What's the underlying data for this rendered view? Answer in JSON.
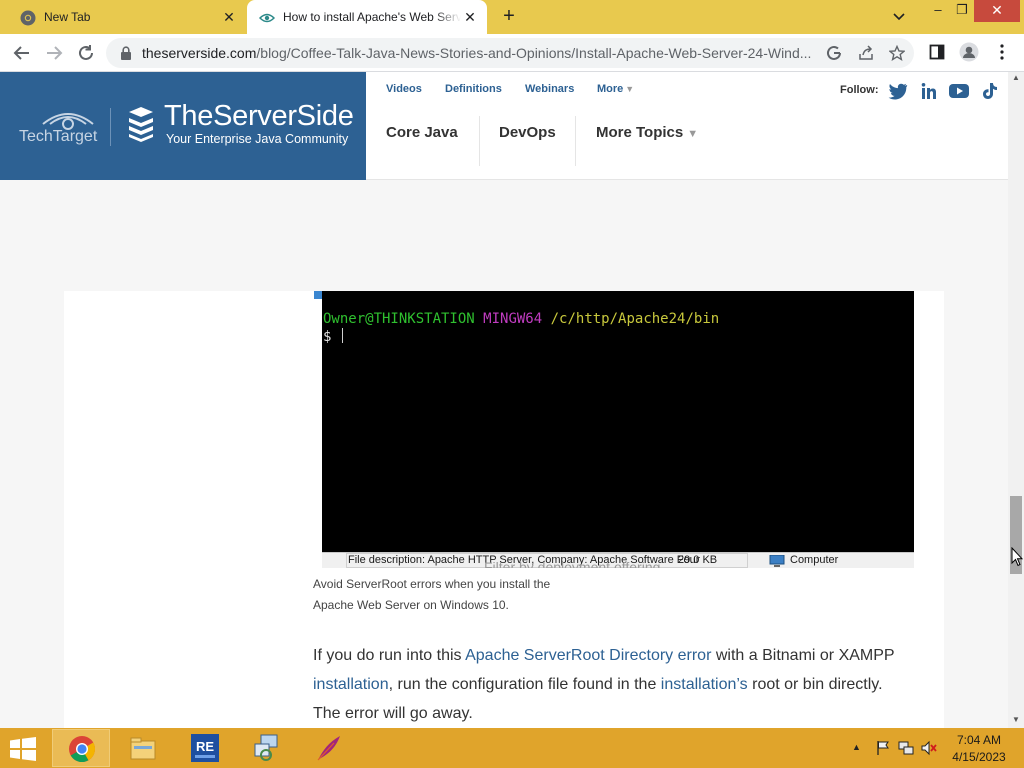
{
  "browser": {
    "tabs": [
      {
        "title": "New Tab",
        "active": false
      },
      {
        "title": "How to install Apache's Web Server",
        "active": true
      }
    ],
    "url_domain": "theserverside.com",
    "url_path": "/blog/Coffee-Talk-Java-News-Stories-and-Opinions/Install-Apache-Web-Server-24-Wind...",
    "colors": {
      "tabstrip": "#e8c94e",
      "close_button": "#c74a3d"
    }
  },
  "site_header": {
    "techtarget": "TechTarget",
    "brand_name": "TheServerSide",
    "tagline": "Your Enterprise Java Community",
    "top_links": [
      "Videos",
      "Definitions",
      "Webinars",
      "More"
    ],
    "follow_label": "Follow:",
    "social_icons": [
      "twitter-icon",
      "linkedin-icon",
      "youtube-icon",
      "tiktok-icon"
    ],
    "main_nav": [
      "Core Java",
      "DevOps",
      "More Topics"
    ],
    "colors": {
      "brand_blue": "#2d6193"
    }
  },
  "article": {
    "terminal": {
      "user_host": "Owner@THINKSTATION",
      "env": "MINGW64",
      "path": "/c/http/Apache24/bin",
      "prompt": "$ "
    },
    "explorer_status": {
      "description": "File description: Apache HTTP Server, Company: Apache Software Foundation",
      "size": "29.0 KB",
      "location": "Computer"
    },
    "behind_text": "Filter by deployment offering",
    "caption": "Avoid ServerRoot errors when you install the Apache Web Server on Windows 10.",
    "paragraph": {
      "t1": "If you do run into this ",
      "link1": "Apache ServerRoot Directory error",
      "t2": " with a Bitnami or XAMPP ",
      "link2": "installation",
      "t3": ", run the configuration file found in the ",
      "link3": "installation’s",
      "t4": " root or bin directly. The error will go away."
    }
  },
  "taskbar": {
    "apps": [
      "chrome-icon",
      "file-explorer-icon",
      "re-app-icon",
      "network-setup-icon",
      "feather-icon"
    ],
    "clock_time": "7:04 AM",
    "clock_date": "4/15/2023",
    "colors": {
      "taskbar": "#e0a42b"
    }
  }
}
